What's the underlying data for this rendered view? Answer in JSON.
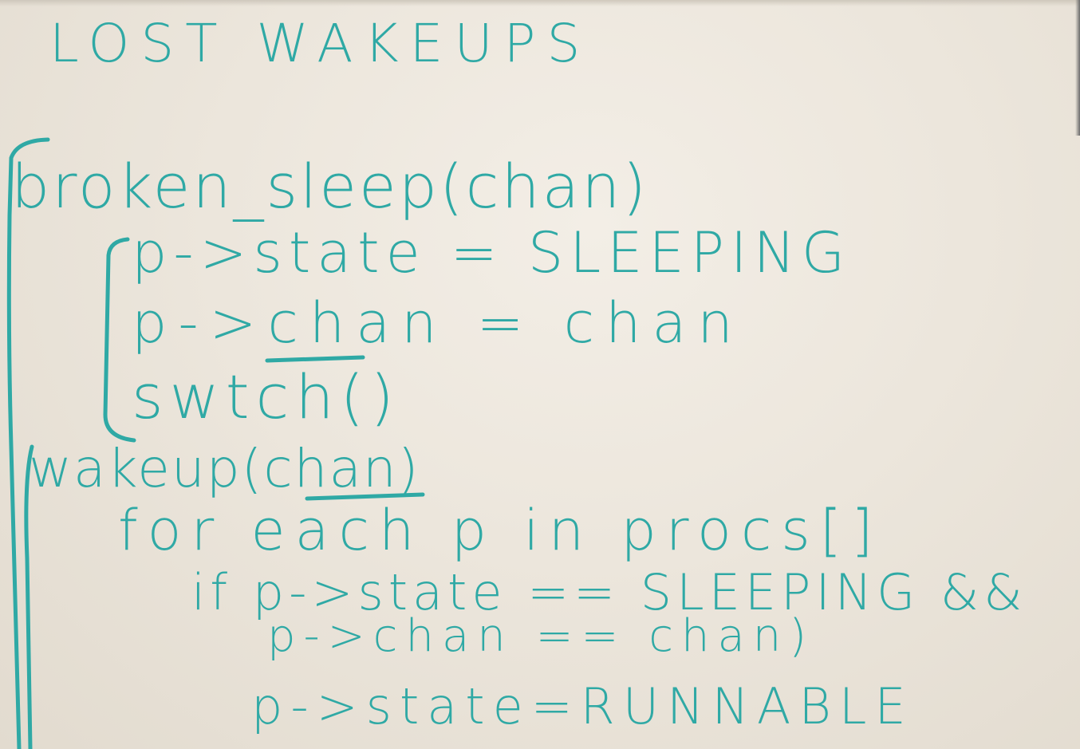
{
  "whiteboard": {
    "title": "LOST WAKEUPS",
    "lines": [
      "broken_sleep(chan)",
      "p->state = SLEEPING",
      "p->chan = chan",
      "swtch()",
      "wakeup(chan)",
      "for each p in procs[]",
      "if p->state == SLEEPING &&",
      "p->chan == chan)",
      "p->state=RUNNABLE"
    ],
    "ink_color": "#2fa9a5"
  }
}
